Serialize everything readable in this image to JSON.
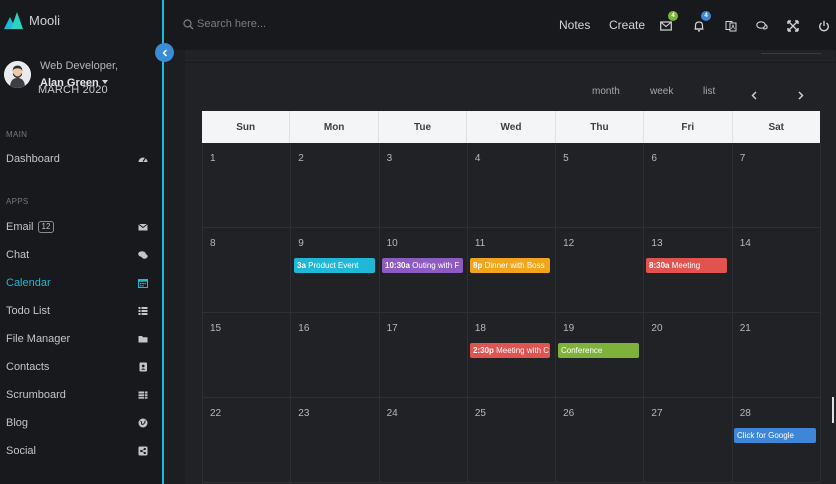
{
  "brand": {
    "name": "Mooli"
  },
  "profile": {
    "role": "Web Developer,",
    "name": "Alan Green"
  },
  "sidebar": {
    "sections": {
      "main": "MAIN",
      "apps": "APPS"
    },
    "items": [
      {
        "label": "Dashboard",
        "icon": "dashboard-icon"
      },
      {
        "label": "Email",
        "badge": "12",
        "icon": "envelope-icon"
      },
      {
        "label": "Chat",
        "icon": "chat-icon"
      },
      {
        "label": "Calendar",
        "icon": "calendar-icon",
        "active": true
      },
      {
        "label": "Todo List",
        "icon": "list-icon"
      },
      {
        "label": "File Manager",
        "icon": "folder-icon"
      },
      {
        "label": "Contacts",
        "icon": "contact-book-icon"
      },
      {
        "label": "Scrumboard",
        "icon": "board-icon"
      },
      {
        "label": "Blog",
        "icon": "globe-icon"
      },
      {
        "label": "Social",
        "icon": "share-icon"
      }
    ]
  },
  "topbar": {
    "search_placeholder": "Search here...",
    "links": {
      "notes": "Notes",
      "create": "Create"
    },
    "mail_badge": "4",
    "bell_badge": "4"
  },
  "calendar": {
    "title": "MARCH 2020",
    "views": {
      "month": "month",
      "week": "week",
      "list": "list"
    },
    "weekdays": [
      "Sun",
      "Mon",
      "Tue",
      "Wed",
      "Thu",
      "Fri",
      "Sat"
    ],
    "weeks": [
      [
        "1",
        "2",
        "3",
        "4",
        "5",
        "6",
        "7"
      ],
      [
        "8",
        "9",
        "10",
        "11",
        "12",
        "13",
        "14"
      ],
      [
        "15",
        "16",
        "17",
        "18",
        "19",
        "20",
        "21"
      ],
      [
        "22",
        "23",
        "24",
        "25",
        "26",
        "27",
        "28"
      ]
    ],
    "events": [
      {
        "time": "3a",
        "title": "Product Event",
        "color": "#1fb8d6"
      },
      {
        "time": "10:30a",
        "title": "Outing with F",
        "color": "#8e5bc2"
      },
      {
        "time": "8p",
        "title": "Dinner with Boss",
        "color": "#f0a51c"
      },
      {
        "time": "8:30a",
        "title": "Meeting",
        "color": "#e0534f"
      },
      {
        "time": "2:30p",
        "title": "Meeting with C",
        "color": "#e0534f"
      },
      {
        "time": "",
        "title": "Conference",
        "color": "#7fb23a"
      },
      {
        "time": "",
        "title": "Click for Google",
        "color": "#3e86d8"
      }
    ]
  },
  "colors": {
    "accent": "#1fb8d6",
    "background": "#17191c",
    "panel": "#202226"
  }
}
